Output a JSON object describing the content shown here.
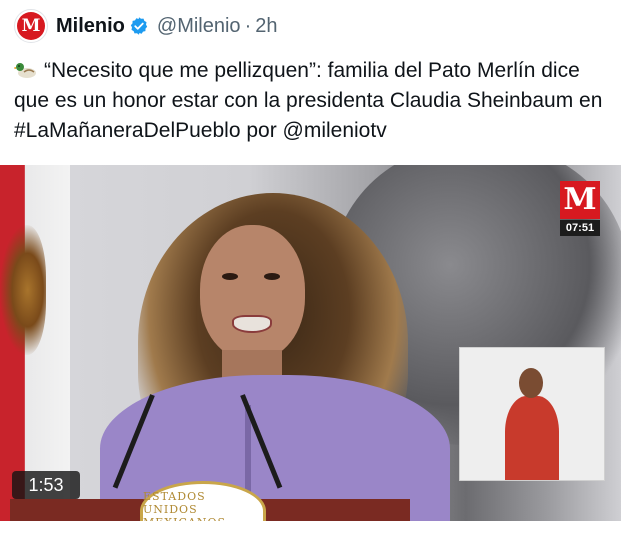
{
  "tweet": {
    "author_name": "Milenio",
    "handle": "@Milenio",
    "separator": "·",
    "timestamp": "2h",
    "avatar_letter": "M",
    "text": "“Necesito que me pellizquen”: familia del Pato Merlín dice que es un honor estar con la presidenta Claudia Sheinbaum en #LaMañaneraDelPueblo por @mileniotv"
  },
  "media": {
    "channel_logo_letter": "M",
    "channel_clock": "07:51",
    "duration": "1:53",
    "seal_text": "ESTADOS UNIDOS MEXICANOS"
  },
  "icons": [
    "duck-icon",
    "verified-badge-icon"
  ],
  "colors": {
    "brand_red": "#d71920",
    "verified_blue": "#1d9bf0",
    "handle_gray": "#536471"
  }
}
